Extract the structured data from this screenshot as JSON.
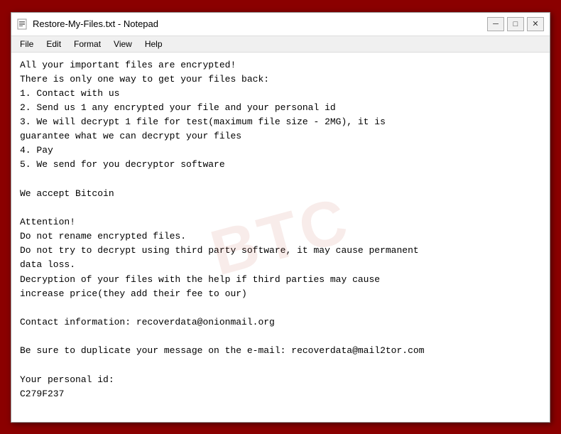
{
  "window": {
    "title": "Restore-My-Files.txt - Notepad",
    "icon": "notepad"
  },
  "titlebar": {
    "minimize_label": "─",
    "maximize_label": "□",
    "close_label": "✕"
  },
  "menu": {
    "items": [
      "File",
      "Edit",
      "Format",
      "View",
      "Help"
    ]
  },
  "content": {
    "text": "All your important files are encrypted!\nThere is only one way to get your files back:\n1. Contact with us\n2. Send us 1 any encrypted your file and your personal id\n3. We will decrypt 1 file for test(maximum file size - 2MG), it is\nguarantee what we can decrypt your files\n4. Pay\n5. We send for you decryptor software\n\nWe accept Bitcoin\n\nAttention!\nDo not rename encrypted files.\nDo not try to decrypt using third party software, it may cause permanent\ndata loss.\nDecryption of your files with the help if third parties may cause\nincrease price(they add their fee to our)\n\nContact information: recoverdata@onionmail.org\n\nBe sure to duplicate your message on the e-mail: recoverdata@mail2tor.com\n\nYour personal id:\nC279F237"
  },
  "watermark": {
    "text": "BTC"
  }
}
